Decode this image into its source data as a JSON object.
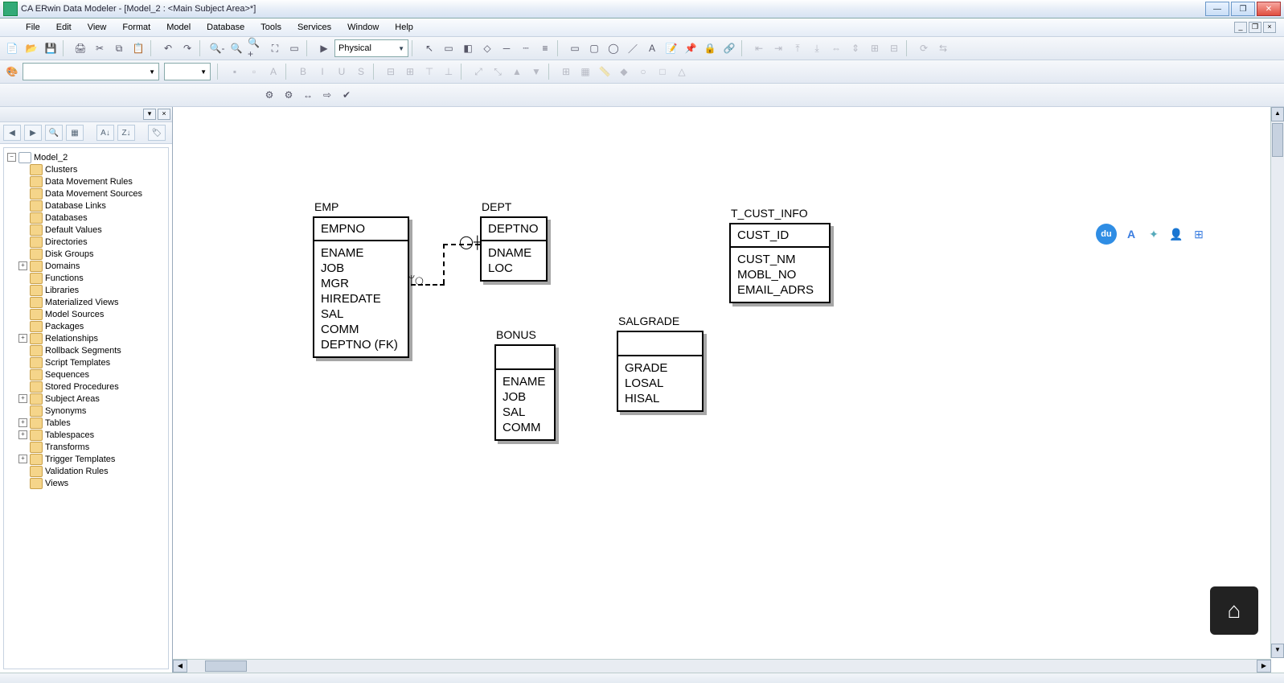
{
  "window": {
    "title": "CA ERwin Data Modeler - [Model_2 : <Main Subject Area>*]"
  },
  "menu": [
    "File",
    "Edit",
    "View",
    "Format",
    "Model",
    "Database",
    "Tools",
    "Services",
    "Window",
    "Help"
  ],
  "viewmode": "Physical",
  "tree": {
    "root": "Model_2",
    "items": [
      {
        "label": "Clusters",
        "exp": null
      },
      {
        "label": "Data Movement Rules",
        "exp": null
      },
      {
        "label": "Data Movement Sources",
        "exp": null
      },
      {
        "label": "Database Links",
        "exp": null
      },
      {
        "label": "Databases",
        "exp": null
      },
      {
        "label": "Default Values",
        "exp": null
      },
      {
        "label": "Directories",
        "exp": null
      },
      {
        "label": "Disk Groups",
        "exp": null
      },
      {
        "label": "Domains",
        "exp": "+"
      },
      {
        "label": "Functions",
        "exp": null
      },
      {
        "label": "Libraries",
        "exp": null
      },
      {
        "label": "Materialized Views",
        "exp": null
      },
      {
        "label": "Model Sources",
        "exp": null
      },
      {
        "label": "Packages",
        "exp": null
      },
      {
        "label": "Relationships",
        "exp": "+"
      },
      {
        "label": "Rollback Segments",
        "exp": null
      },
      {
        "label": "Script Templates",
        "exp": null
      },
      {
        "label": "Sequences",
        "exp": null
      },
      {
        "label": "Stored Procedures",
        "exp": null
      },
      {
        "label": "Subject Areas",
        "exp": "+"
      },
      {
        "label": "Synonyms",
        "exp": null
      },
      {
        "label": "Tables",
        "exp": "+"
      },
      {
        "label": "Tablespaces",
        "exp": "+"
      },
      {
        "label": "Transforms",
        "exp": null
      },
      {
        "label": "Trigger Templates",
        "exp": "+"
      },
      {
        "label": "Validation Rules",
        "exp": null
      },
      {
        "label": "Views",
        "exp": null
      }
    ]
  },
  "entities": {
    "emp": {
      "name": "EMP",
      "pk": [
        "EMPNO"
      ],
      "attrs": [
        "ENAME",
        "JOB",
        "MGR",
        "HIREDATE",
        "SAL",
        "COMM",
        "DEPTNO (FK)"
      ]
    },
    "dept": {
      "name": "DEPT",
      "pk": [
        "DEPTNO"
      ],
      "attrs": [
        "DNAME",
        "LOC"
      ]
    },
    "bonus": {
      "name": "BONUS",
      "pk": [],
      "attrs": [
        "ENAME",
        "JOB",
        "SAL",
        "COMM"
      ]
    },
    "salgrade": {
      "name": "SALGRADE",
      "pk": [],
      "attrs": [
        "GRADE",
        "LOSAL",
        "HISAL"
      ]
    },
    "tcust": {
      "name": "T_CUST_INFO",
      "pk": [
        "CUST_ID"
      ],
      "attrs": [
        "CUST_NM",
        "MOBL_NO",
        "EMAIL_ADRS"
      ]
    }
  },
  "float": {
    "du": "du"
  }
}
